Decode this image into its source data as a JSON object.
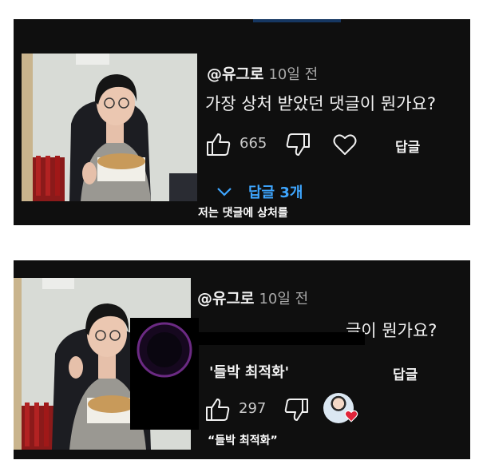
{
  "panel1": {
    "username": "@유그로",
    "time": "10일 전",
    "comment": "가장 상처 받았던 댓글이 뭔가요?",
    "like_count": "665",
    "reply_label": "답글",
    "replies_label": "답글 3개",
    "subtitle": "저는 댓글에 상처를",
    "icons": [
      "thumbs-up-icon",
      "thumbs-down-icon",
      "heart-icon",
      "chevron-down-icon"
    ]
  },
  "panel2": {
    "username": "@유그로",
    "time": "10일 전",
    "comment_visible": "글이 뭔가요?",
    "quoted_reply": "'들박 최적화'",
    "reply_label": "답글",
    "like_count": "297",
    "subtitle": "“들박 최적화”",
    "icons": [
      "thumbs-up-icon",
      "thumbs-down-icon",
      "creator-heart-icon"
    ]
  },
  "colors": {
    "panel_bg": "#0f0f0f",
    "text": "#f1f1f1",
    "muted": "#a9a9a9",
    "link_blue": "#3ea6ff",
    "heart_red": "#e0243a"
  }
}
